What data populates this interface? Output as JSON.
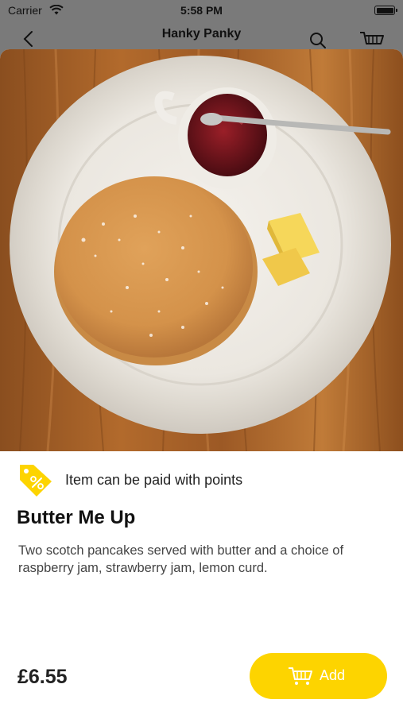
{
  "status_bar": {
    "carrier": "Carrier",
    "time": "5:58 PM"
  },
  "nav": {
    "title": "Hanky Panky",
    "back_icon": "chevron-left-icon",
    "search_icon": "search-icon",
    "cart_icon": "cart-icon"
  },
  "product": {
    "image_alt": "Scotch pancake on a white plate with jam and butter",
    "points_note": "Item can be paid with points",
    "name": "Butter Me Up",
    "description": "Two scotch pancakes served with butter and a choice of raspberry jam, strawberry jam, lemon curd.",
    "price": "£6.55"
  },
  "actions": {
    "add_label": "Add"
  },
  "colors": {
    "accent": "#FDD400",
    "text": "#111111",
    "muted": "#444444",
    "overlay": "#7a7a7a"
  }
}
